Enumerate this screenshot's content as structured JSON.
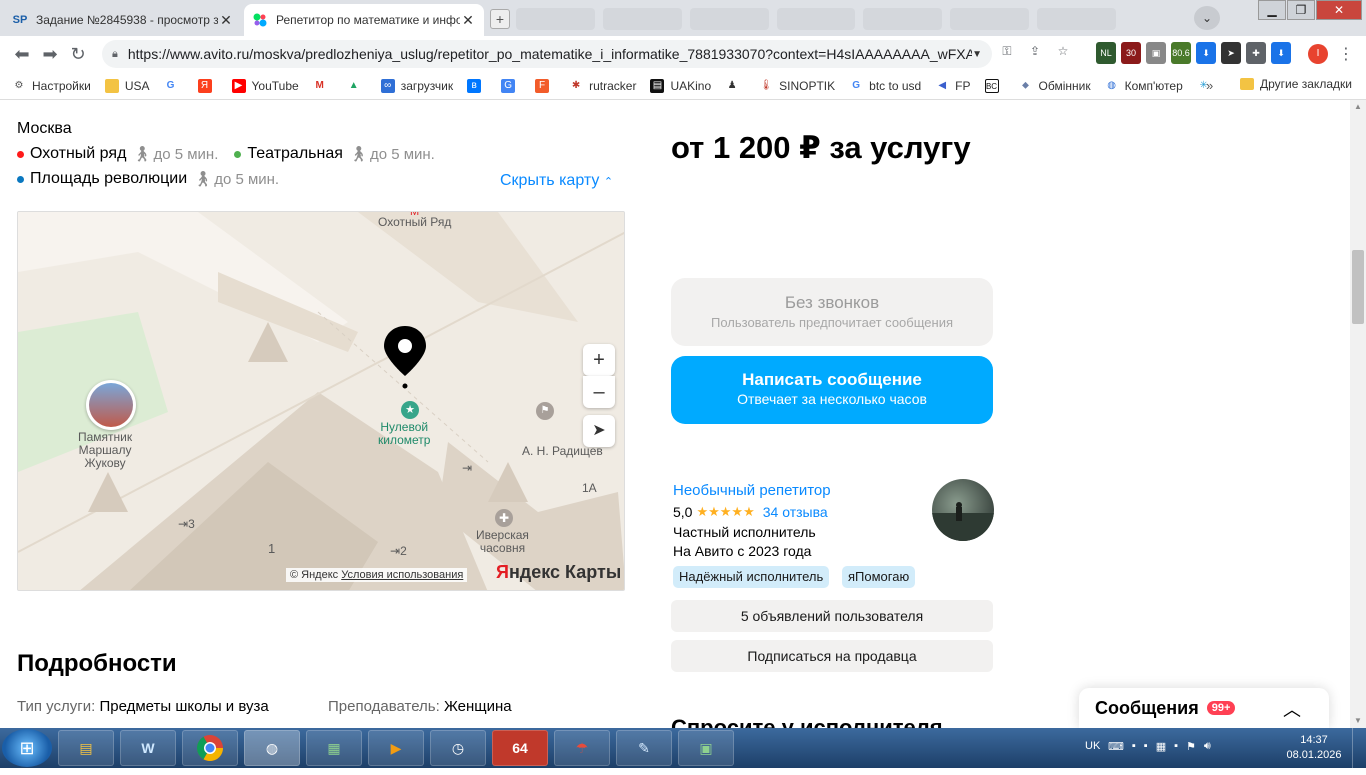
{
  "browser": {
    "tabs": [
      {
        "favicon": "SP",
        "title": "Задание №2845938 - просмотр з",
        "active": false
      },
      {
        "favicon": "avito",
        "title": "Репетитор по математике и инфо",
        "active": true
      }
    ],
    "url": "https://www.avito.ru/moskva/predlozheniya_uslug/repetitor_po_matematike_i_informatike_7881933070?context=H4sIAAAAAAAA_wFXA...",
    "extensions": {
      "nl": "NL",
      "count30": "30",
      "ltc": "LTC",
      "ltc_val": "80.6"
    },
    "profile_letter": "I",
    "bookmarks": [
      {
        "label": "Настройки",
        "icon": "gear-icon"
      },
      {
        "label": "USA",
        "icon": "folder-icon"
      },
      {
        "label": "",
        "icon": "google-icon"
      },
      {
        "label": "",
        "icon": "yandex-icon"
      },
      {
        "label": "YouTube",
        "icon": "youtube-icon"
      },
      {
        "label": "",
        "icon": "gmail-icon"
      },
      {
        "label": "",
        "icon": "drive-icon"
      },
      {
        "label": "загрузчик",
        "icon": "infinity-icon"
      },
      {
        "label": "",
        "icon": "vk-icon"
      },
      {
        "label": "",
        "icon": "translate-icon"
      },
      {
        "label": "",
        "icon": "f-icon"
      },
      {
        "label": "rutracker",
        "icon": "rutracker-icon"
      },
      {
        "label": "UAKino",
        "icon": "uakino-icon"
      },
      {
        "label": "",
        "icon": "person-icon"
      },
      {
        "label": "SINOPTIK",
        "icon": "thermometer-icon"
      },
      {
        "label": "btc to usd",
        "icon": "google-icon"
      },
      {
        "label": "FP",
        "icon": "fp-icon"
      },
      {
        "label": "",
        "icon": "bc-icon"
      },
      {
        "label": "Обмінник",
        "icon": "exchange-icon"
      },
      {
        "label": "Комп'ютер",
        "icon": "computer-icon"
      },
      {
        "label": "",
        "icon": "star-icon"
      }
    ],
    "bookmarks_more": "»",
    "other_bookmarks": "Другие закладки"
  },
  "location": {
    "city": "Москва",
    "metro": [
      {
        "name": "Охотный ряд",
        "walk": "до 5 мин.",
        "color": "#ff1a1a"
      },
      {
        "name": "Театральная",
        "walk": "до 5 мин.",
        "color": "#4fb04f"
      },
      {
        "name": "Площадь революции",
        "walk": "до 5 мин.",
        "color": "#0a78c0"
      }
    ],
    "hide_map": "Скрыть карту"
  },
  "map": {
    "labels": {
      "okhotny": "Охотный Ряд",
      "monument": "Памятник\nМаршалу\nЖукову",
      "zero_km": "Нулевой\nкилометр",
      "radishchev": "А. Н. Радищев",
      "iverskaya": "Иверская\nчасовня",
      "n1a": "1А",
      "n3": "3",
      "n1": "1",
      "n2": "2"
    },
    "zoom_in": "+",
    "zoom_out": "–",
    "copyright": "© Яндекс",
    "terms": "Условия использования",
    "brand_y": "Я",
    "brand_rest": "ндекс Карты"
  },
  "details": {
    "title": "Подробности",
    "service_type_key": "Тип услуги:",
    "service_type_val": "Предметы школы и вуза",
    "teacher_key": "Преподаватель:",
    "teacher_val": "Женщина"
  },
  "offer": {
    "price": "от 1 200 ₽ за услугу",
    "nocall_title": "Без звонков",
    "nocall_sub": "Пользователь предпочитает сообщения",
    "msg_title": "Написать сообщение",
    "msg_sub": "Отвечает за несколько часов"
  },
  "seller": {
    "name": "Необычный репетитор",
    "rating": "5,0",
    "stars": "★★★★★",
    "reviews": "34 отзыва",
    "type": "Частный исполнитель",
    "since": "На Авито с 2023 года",
    "badges": [
      "Надёжный исполнитель",
      "яПомогаю"
    ],
    "listings_btn": "5 объявлений пользователя",
    "subscribe_btn": "Подписаться на продавца",
    "next_heading": "Спросите у исполнителя"
  },
  "messages": {
    "title": "Сообщения",
    "count": "99+"
  },
  "taskbar": {
    "lang": "UK",
    "time": "14:37",
    "date": "08.01.2026",
    "items": [
      "explorer",
      "webroot",
      "chrome",
      "network",
      "game",
      "media",
      "clock",
      "64",
      "umbrella",
      "notepad",
      "terminal"
    ]
  }
}
